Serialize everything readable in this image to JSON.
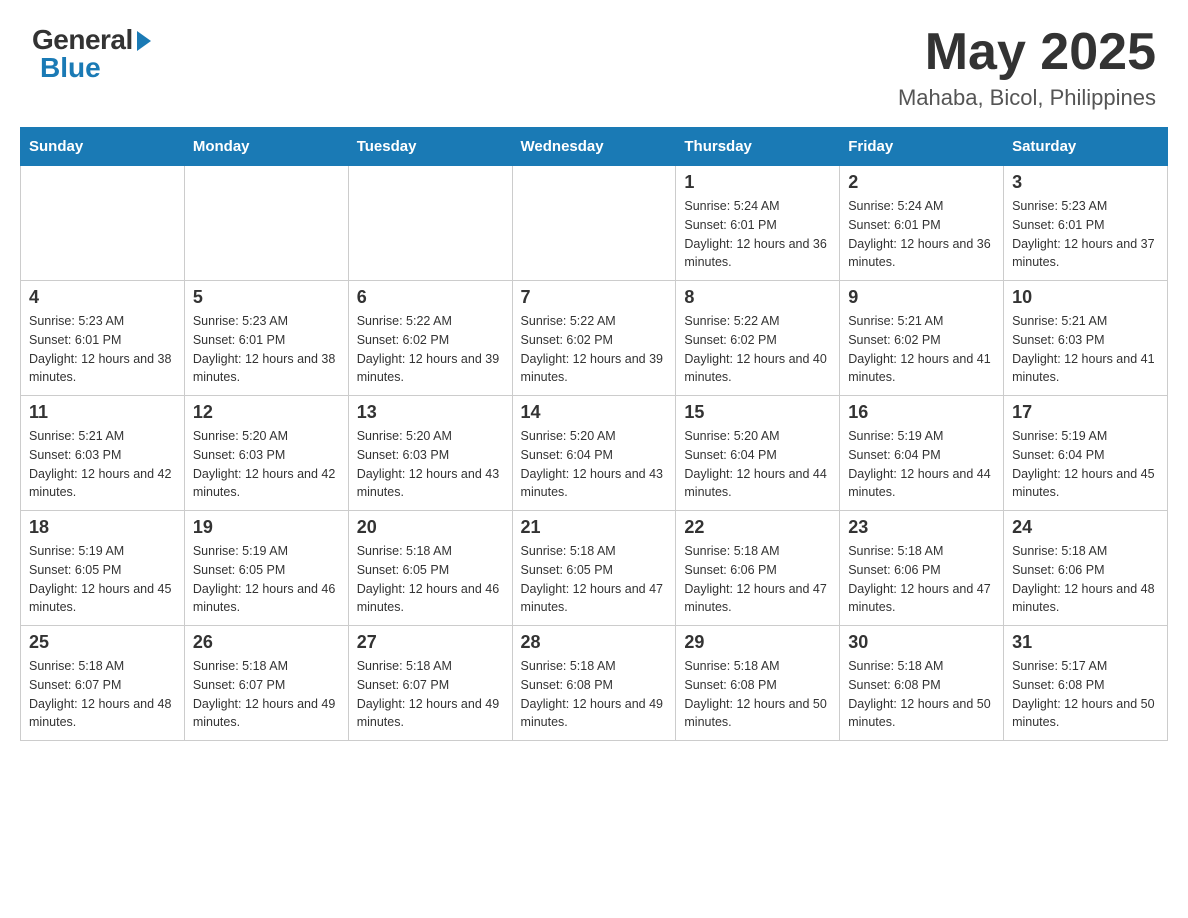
{
  "header": {
    "logo_general": "General",
    "logo_blue": "Blue",
    "month_year": "May 2025",
    "location": "Mahaba, Bicol, Philippines"
  },
  "days_of_week": [
    "Sunday",
    "Monday",
    "Tuesday",
    "Wednesday",
    "Thursday",
    "Friday",
    "Saturday"
  ],
  "weeks": [
    [
      {
        "day": "",
        "info": ""
      },
      {
        "day": "",
        "info": ""
      },
      {
        "day": "",
        "info": ""
      },
      {
        "day": "",
        "info": ""
      },
      {
        "day": "1",
        "info": "Sunrise: 5:24 AM\nSunset: 6:01 PM\nDaylight: 12 hours and 36 minutes."
      },
      {
        "day": "2",
        "info": "Sunrise: 5:24 AM\nSunset: 6:01 PM\nDaylight: 12 hours and 36 minutes."
      },
      {
        "day": "3",
        "info": "Sunrise: 5:23 AM\nSunset: 6:01 PM\nDaylight: 12 hours and 37 minutes."
      }
    ],
    [
      {
        "day": "4",
        "info": "Sunrise: 5:23 AM\nSunset: 6:01 PM\nDaylight: 12 hours and 38 minutes."
      },
      {
        "day": "5",
        "info": "Sunrise: 5:23 AM\nSunset: 6:01 PM\nDaylight: 12 hours and 38 minutes."
      },
      {
        "day": "6",
        "info": "Sunrise: 5:22 AM\nSunset: 6:02 PM\nDaylight: 12 hours and 39 minutes."
      },
      {
        "day": "7",
        "info": "Sunrise: 5:22 AM\nSunset: 6:02 PM\nDaylight: 12 hours and 39 minutes."
      },
      {
        "day": "8",
        "info": "Sunrise: 5:22 AM\nSunset: 6:02 PM\nDaylight: 12 hours and 40 minutes."
      },
      {
        "day": "9",
        "info": "Sunrise: 5:21 AM\nSunset: 6:02 PM\nDaylight: 12 hours and 41 minutes."
      },
      {
        "day": "10",
        "info": "Sunrise: 5:21 AM\nSunset: 6:03 PM\nDaylight: 12 hours and 41 minutes."
      }
    ],
    [
      {
        "day": "11",
        "info": "Sunrise: 5:21 AM\nSunset: 6:03 PM\nDaylight: 12 hours and 42 minutes."
      },
      {
        "day": "12",
        "info": "Sunrise: 5:20 AM\nSunset: 6:03 PM\nDaylight: 12 hours and 42 minutes."
      },
      {
        "day": "13",
        "info": "Sunrise: 5:20 AM\nSunset: 6:03 PM\nDaylight: 12 hours and 43 minutes."
      },
      {
        "day": "14",
        "info": "Sunrise: 5:20 AM\nSunset: 6:04 PM\nDaylight: 12 hours and 43 minutes."
      },
      {
        "day": "15",
        "info": "Sunrise: 5:20 AM\nSunset: 6:04 PM\nDaylight: 12 hours and 44 minutes."
      },
      {
        "day": "16",
        "info": "Sunrise: 5:19 AM\nSunset: 6:04 PM\nDaylight: 12 hours and 44 minutes."
      },
      {
        "day": "17",
        "info": "Sunrise: 5:19 AM\nSunset: 6:04 PM\nDaylight: 12 hours and 45 minutes."
      }
    ],
    [
      {
        "day": "18",
        "info": "Sunrise: 5:19 AM\nSunset: 6:05 PM\nDaylight: 12 hours and 45 minutes."
      },
      {
        "day": "19",
        "info": "Sunrise: 5:19 AM\nSunset: 6:05 PM\nDaylight: 12 hours and 46 minutes."
      },
      {
        "day": "20",
        "info": "Sunrise: 5:18 AM\nSunset: 6:05 PM\nDaylight: 12 hours and 46 minutes."
      },
      {
        "day": "21",
        "info": "Sunrise: 5:18 AM\nSunset: 6:05 PM\nDaylight: 12 hours and 47 minutes."
      },
      {
        "day": "22",
        "info": "Sunrise: 5:18 AM\nSunset: 6:06 PM\nDaylight: 12 hours and 47 minutes."
      },
      {
        "day": "23",
        "info": "Sunrise: 5:18 AM\nSunset: 6:06 PM\nDaylight: 12 hours and 47 minutes."
      },
      {
        "day": "24",
        "info": "Sunrise: 5:18 AM\nSunset: 6:06 PM\nDaylight: 12 hours and 48 minutes."
      }
    ],
    [
      {
        "day": "25",
        "info": "Sunrise: 5:18 AM\nSunset: 6:07 PM\nDaylight: 12 hours and 48 minutes."
      },
      {
        "day": "26",
        "info": "Sunrise: 5:18 AM\nSunset: 6:07 PM\nDaylight: 12 hours and 49 minutes."
      },
      {
        "day": "27",
        "info": "Sunrise: 5:18 AM\nSunset: 6:07 PM\nDaylight: 12 hours and 49 minutes."
      },
      {
        "day": "28",
        "info": "Sunrise: 5:18 AM\nSunset: 6:08 PM\nDaylight: 12 hours and 49 minutes."
      },
      {
        "day": "29",
        "info": "Sunrise: 5:18 AM\nSunset: 6:08 PM\nDaylight: 12 hours and 50 minutes."
      },
      {
        "day": "30",
        "info": "Sunrise: 5:18 AM\nSunset: 6:08 PM\nDaylight: 12 hours and 50 minutes."
      },
      {
        "day": "31",
        "info": "Sunrise: 5:17 AM\nSunset: 6:08 PM\nDaylight: 12 hours and 50 minutes."
      }
    ]
  ]
}
